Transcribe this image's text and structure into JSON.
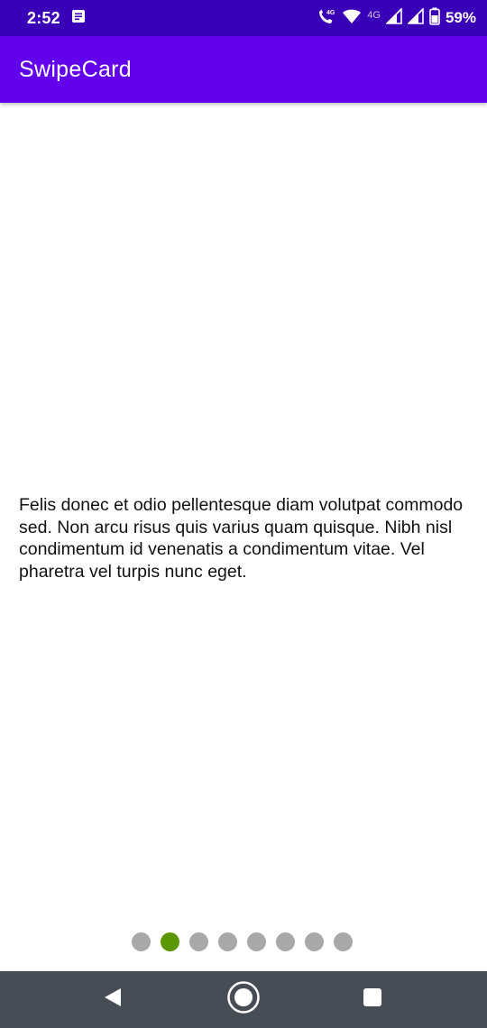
{
  "status_bar": {
    "time": "2:52",
    "battery_percent": "59%",
    "network_label": "4G",
    "icons": [
      "notes-icon",
      "volte-call-icon",
      "wifi-icon",
      "signal-icon",
      "signal-icon",
      "battery-icon"
    ]
  },
  "app_bar": {
    "title": "SwipeCard"
  },
  "card": {
    "text": "Felis donec et odio pellentesque diam volutpat commodo sed. Non arcu risus quis varius quam quisque. Nibh nisl condimentum id venenatis a condimentum vitae. Vel pharetra vel turpis nunc eget."
  },
  "pager": {
    "page_count": 8,
    "current_page": 2
  },
  "colors": {
    "status_bar": "#3a00b8",
    "app_bar": "#6200ee",
    "dot_inactive": "#a8a8a8",
    "dot_active": "#5a9600",
    "nav_bar": "#474d55"
  },
  "nav_bar": {
    "buttons": [
      "back-icon",
      "home-icon",
      "recents-icon"
    ]
  }
}
